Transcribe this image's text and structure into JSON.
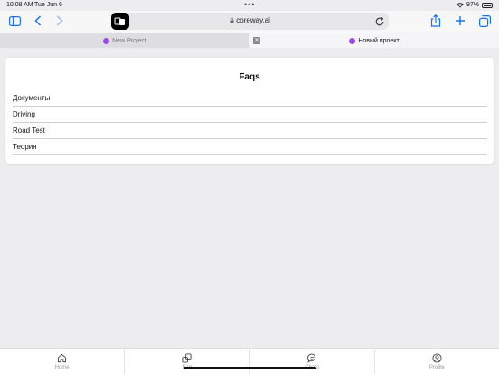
{
  "status_bar": {
    "time": "10:08 AM",
    "date": "Tue Jun 6",
    "battery": "97%"
  },
  "browser": {
    "url": "coreway.ai"
  },
  "tabs": [
    {
      "label": "New Project"
    },
    {
      "label": "Новый проект"
    }
  ],
  "faq": {
    "title": "Faqs",
    "items": [
      "Документы",
      "Driving",
      "Road Test",
      "Теория"
    ]
  },
  "bottom_nav": [
    {
      "label": "Home",
      "icon": "home-icon"
    },
    {
      "label": "Faq",
      "icon": "faq-icon"
    },
    {
      "label": "Chats",
      "icon": "chat-icon"
    },
    {
      "label": "Profile",
      "icon": "profile-icon"
    }
  ]
}
